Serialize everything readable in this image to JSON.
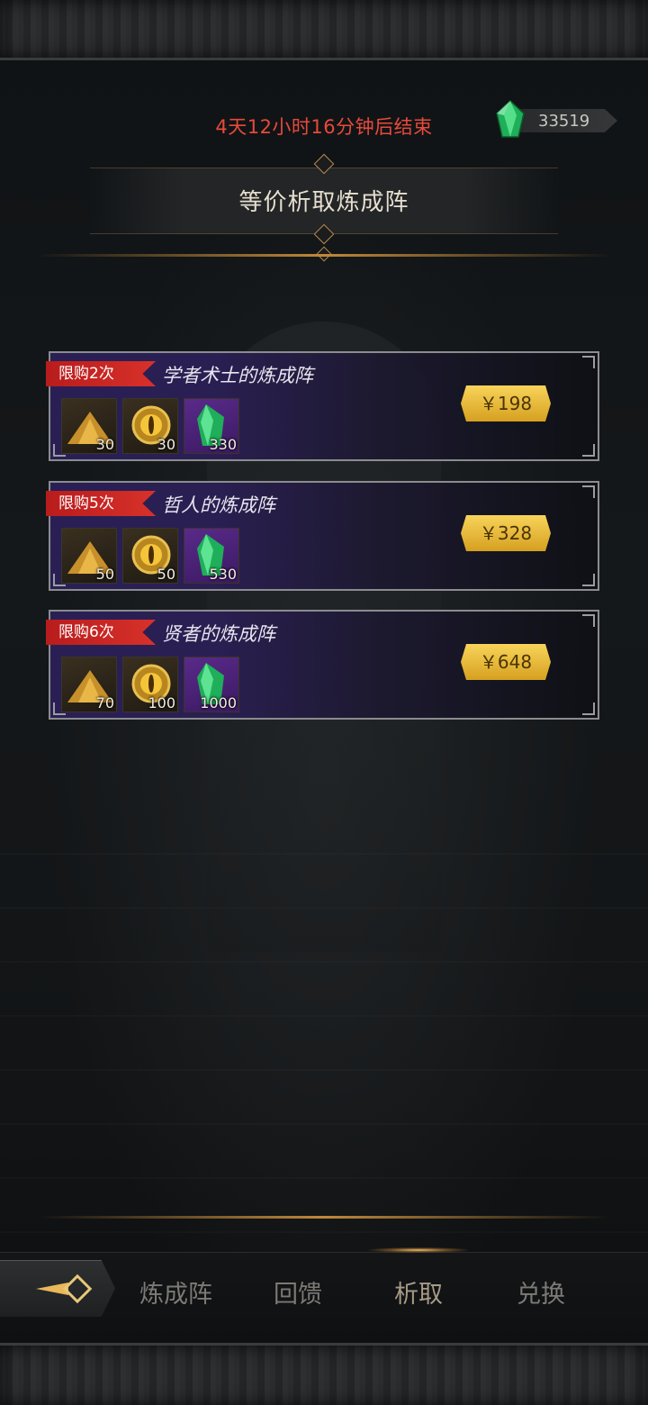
{
  "header": {
    "timer_text": "4天12小时16分钟后结束",
    "currency": {
      "icon": "green-crystal-icon",
      "value": "33519"
    },
    "title": "等价析取炼成阵"
  },
  "offers": [
    {
      "limit": "限购2次",
      "title": "学者术士的炼成阵",
      "price": "￥198",
      "items": [
        {
          "icon": "gold-dust-pile-icon",
          "qty": "30"
        },
        {
          "icon": "golden-eye-orb-icon",
          "qty": "30"
        },
        {
          "icon": "green-crystal-icon",
          "qty": "330"
        }
      ]
    },
    {
      "limit": "限购5次",
      "title": "哲人的炼成阵",
      "price": "￥328",
      "items": [
        {
          "icon": "gold-dust-pile-icon",
          "qty": "50"
        },
        {
          "icon": "golden-eye-orb-icon",
          "qty": "50"
        },
        {
          "icon": "green-crystal-icon",
          "qty": "530"
        }
      ]
    },
    {
      "limit": "限购6次",
      "title": "贤者的炼成阵",
      "price": "￥648",
      "items": [
        {
          "icon": "gold-dust-pile-icon",
          "qty": "70"
        },
        {
          "icon": "golden-eye-orb-icon",
          "qty": "100"
        },
        {
          "icon": "green-crystal-icon",
          "qty": "1000"
        }
      ]
    }
  ],
  "tabs": [
    {
      "label": "炼成阵",
      "active": false
    },
    {
      "label": "回馈",
      "active": false
    },
    {
      "label": "析取",
      "active": true
    },
    {
      "label": "兑换",
      "active": false
    }
  ],
  "colors": {
    "timer": "#e84a3a",
    "price_button": "#f0c040",
    "limit_tag": "#c82020",
    "card_purple": "#2a1f55"
  }
}
